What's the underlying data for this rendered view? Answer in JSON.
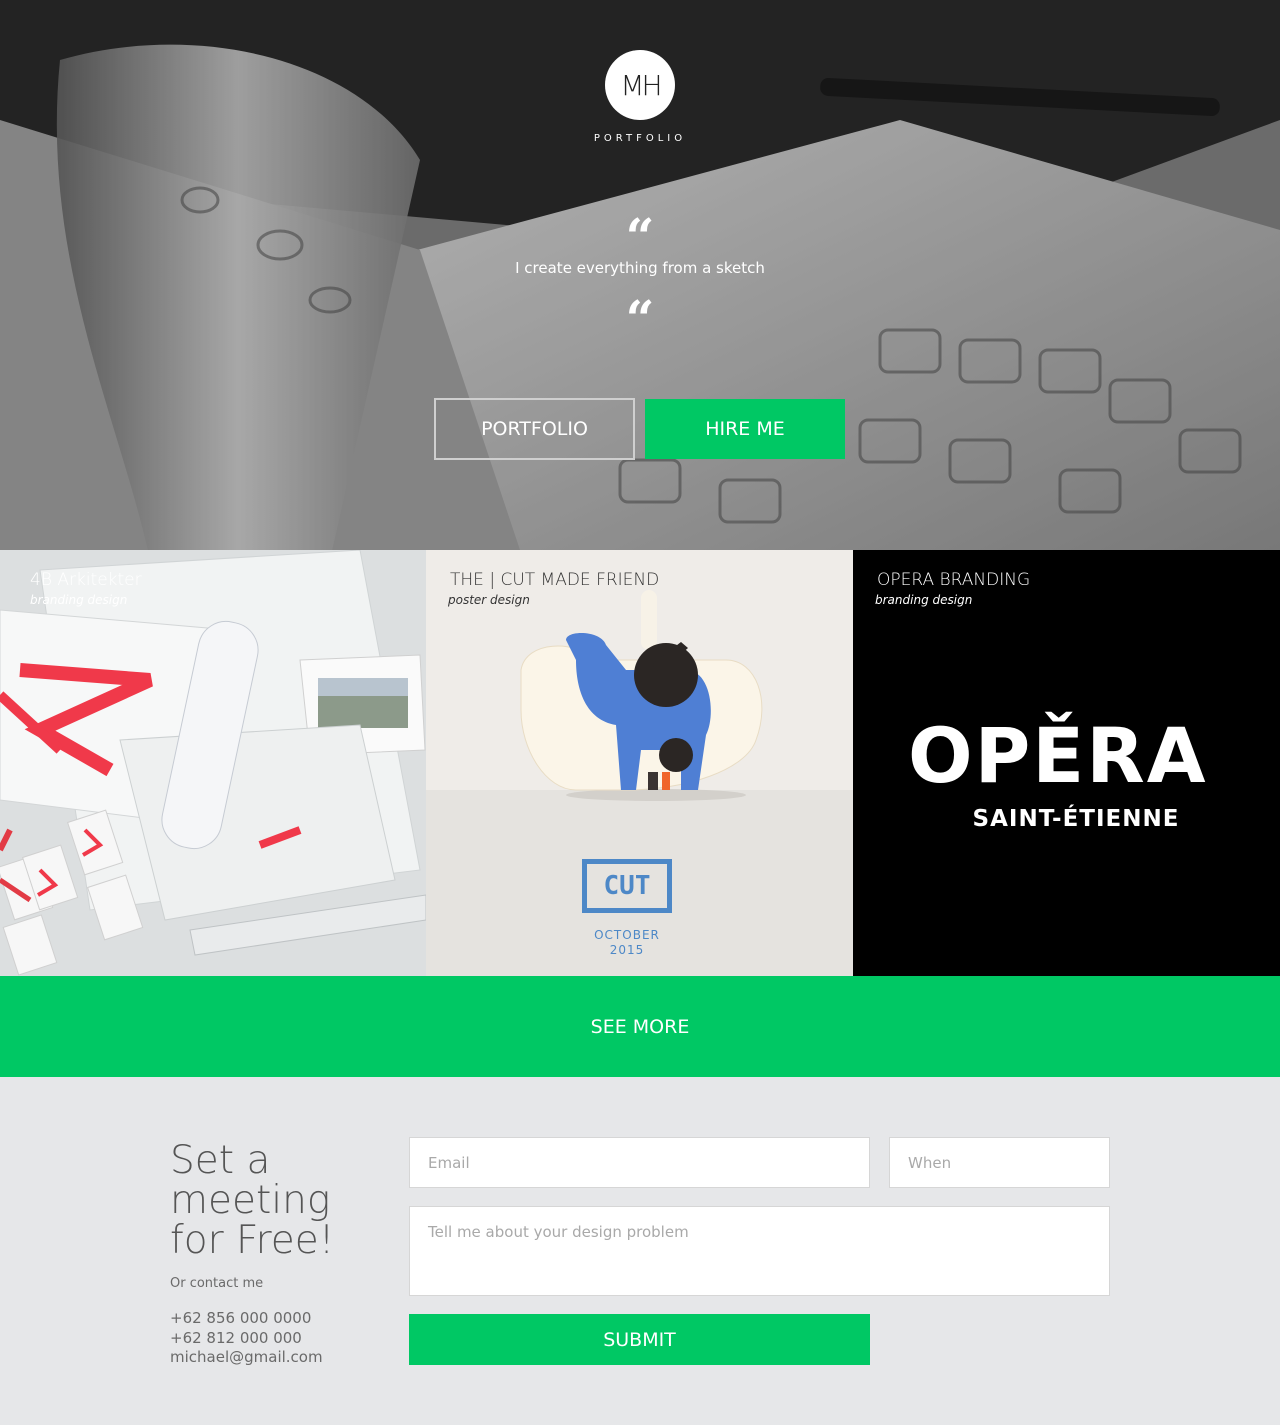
{
  "hero": {
    "logo_text": "MH",
    "logo_label": "PORTFOLIO",
    "quote_open": "“",
    "quote_close": "“",
    "tagline": "I create everything from a sketch",
    "buttons": {
      "portfolio": "PORTFOLIO",
      "hire": "HIRE ME"
    }
  },
  "portfolio": {
    "items": [
      {
        "title": "4B Arkitekter",
        "category": "branding design"
      },
      {
        "title": "THE | CUT MADE FRIEND",
        "category": "poster design",
        "poster_logo": "CUT",
        "poster_month": "OCTOBER",
        "poster_year": "2015"
      },
      {
        "title": "OPERA BRANDING",
        "category": "branding design",
        "logo_word": "OPĚRA",
        "logo_sub": "SAINT-ÉTIENNE"
      }
    ],
    "see_more": "SEE MORE"
  },
  "contact": {
    "title_lines": [
      "Set a",
      "meeting",
      "for Free!"
    ],
    "or_contact": "Or contact me",
    "phone_1": "+62 856 000 0000",
    "phone_2": "+62 812 000 000",
    "email": "michael@gmail.com",
    "form": {
      "email_placeholder": "Email",
      "when_placeholder": "When",
      "message_placeholder": "Tell me about your design problem",
      "submit": "SUBMIT"
    }
  },
  "colors": {
    "accent": "#00c864",
    "cut_blue": "#4d88c7",
    "contact_bg": "#e6e7e9"
  }
}
